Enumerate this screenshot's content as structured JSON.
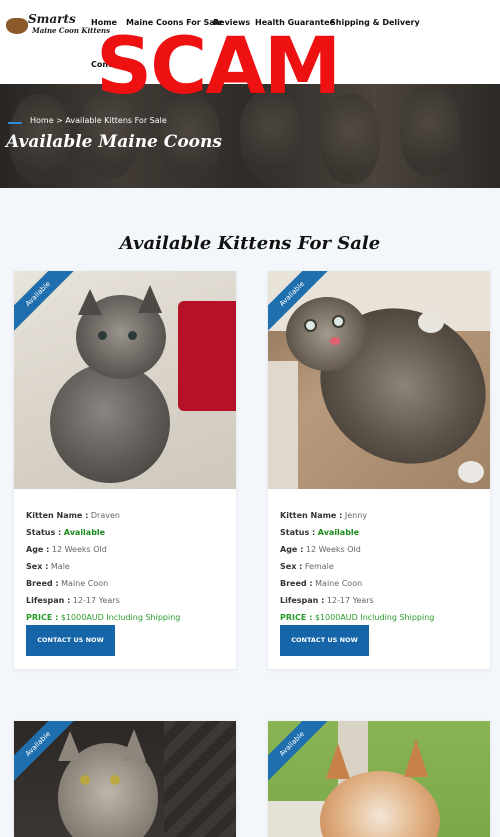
{
  "site": {
    "logo_line1": "Smarts",
    "logo_line2": "Maine Coon Kittens"
  },
  "nav": {
    "items": [
      "Home",
      "Maine Coons For Sale",
      "Reviews",
      "Health Guarantee",
      "Shipping & Delivery"
    ],
    "second_row": "Contact Us"
  },
  "overlay": {
    "text": "SCAM"
  },
  "banner": {
    "breadcrumb": "Home > Available Kittens For Sale",
    "title": "Available Maine Coons"
  },
  "section": {
    "title": "Available Kittens For Sale"
  },
  "labels": {
    "name": "Kitten Name :",
    "status": "Status :",
    "age": "Age :",
    "sex": "Sex :",
    "breed": "Breed :",
    "lifespan": "Lifespan :",
    "price": "PRICE :",
    "ribbon": "Available",
    "contact": "CONTACT US NOW"
  },
  "kittens": [
    {
      "name": "Draven",
      "status": "Available",
      "age": "12 Weeks Old",
      "sex": "Male",
      "breed": "Maine Coon",
      "lifespan": "12-17 Years",
      "price": "$1000AUD Including Shipping"
    },
    {
      "name": "Jenny",
      "status": "Available",
      "age": "12 Weeks Old",
      "sex": "Female",
      "breed": "Maine Coon",
      "lifespan": "12-17 Years",
      "price": "$1000AUD Including Shipping"
    },
    {
      "name": "",
      "status": "",
      "age": "",
      "sex": "",
      "breed": "",
      "lifespan": "",
      "price": ""
    },
    {
      "name": "",
      "status": "",
      "age": "",
      "sex": "",
      "breed": "",
      "lifespan": "",
      "price": ""
    }
  ],
  "colors": {
    "accent": "#1565a8",
    "available_green": "#1a8a1a",
    "scam_red": "#ee1111",
    "ribbon": "#1f6fae"
  }
}
